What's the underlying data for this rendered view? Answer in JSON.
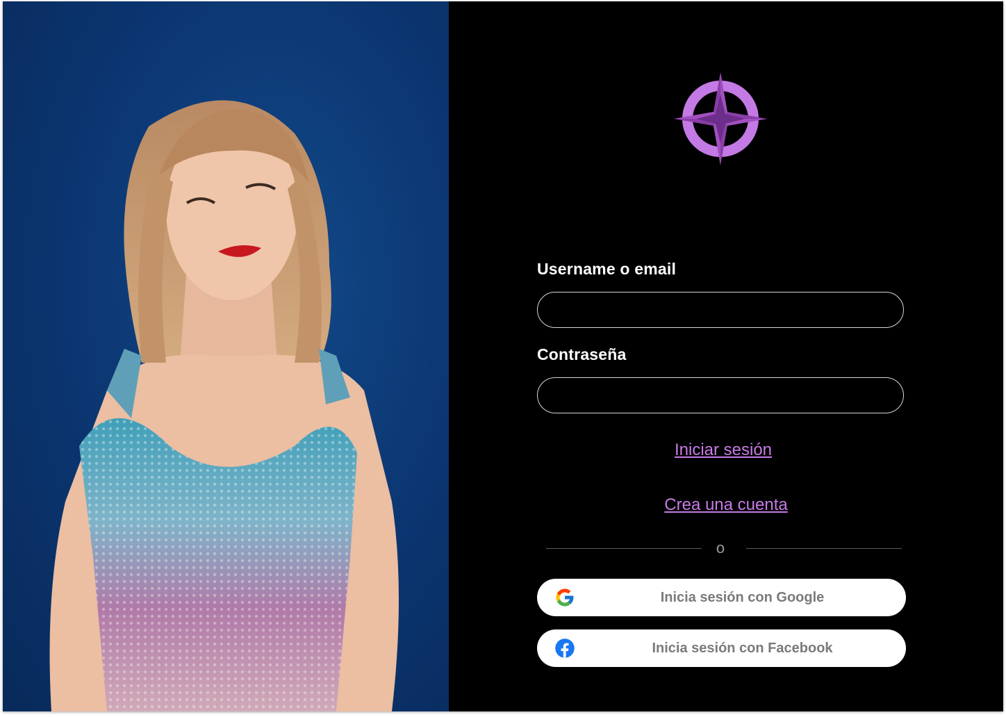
{
  "photo": {
    "alt": "concert-performer-photo"
  },
  "logo": {
    "icon": "compass-rose-icon",
    "color": "#b96ad9"
  },
  "form": {
    "username_label": "Username o email",
    "username_value": "",
    "password_label": "Contraseña",
    "password_value": "",
    "login_link": "Iniciar sesión",
    "signup_link": "Crea una cuenta",
    "separator": "o"
  },
  "social": {
    "google_label": "Inicia sesión con Google",
    "google_icon": "google-icon",
    "facebook_label": "Inicia sesión con Facebook",
    "facebook_icon": "facebook-icon"
  },
  "colors": {
    "accent": "#c77be6",
    "panel_bg": "#000000",
    "photo_bg": "#0b3570"
  }
}
